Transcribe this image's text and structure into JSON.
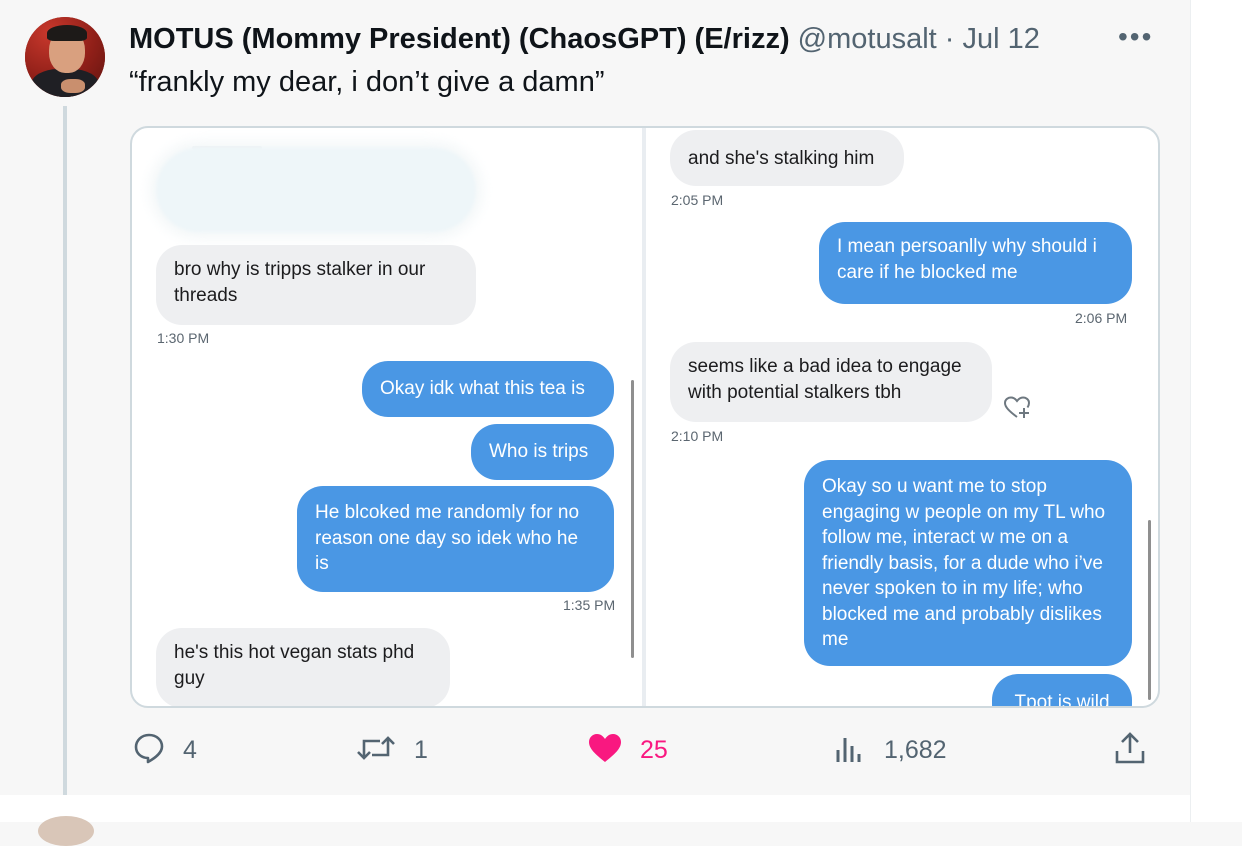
{
  "tweet": {
    "display_name": "MOTUS (Mommy President) (ChaosGPT) (E/rizz)",
    "handle": "@motusalt",
    "separator": "·",
    "date": "Jul 12",
    "more_label": "•••",
    "text": "“frankly my dear, i don’t give a damn”"
  },
  "screenshot": {
    "left": {
      "messages": [
        {
          "dir": "in",
          "text": "bro why is tripps stalker in our threads"
        },
        {
          "dir": "out",
          "text": "Okay idk what this tea is"
        },
        {
          "dir": "out",
          "text": "Who is trips"
        },
        {
          "dir": "out",
          "text": "He blcoked me randomly for no reason one day so idek who he is"
        },
        {
          "dir": "in",
          "text": "he's this hot vegan stats phd guy"
        }
      ],
      "times": [
        "1:30 PM",
        "1:35 PM"
      ]
    },
    "right": {
      "messages": [
        {
          "dir": "in",
          "text": "and she's stalking him"
        },
        {
          "dir": "out",
          "text": "I mean persoanlly why should i care if he blocked me"
        },
        {
          "dir": "in",
          "text": "seems like a bad idea to engage with potential stalkers tbh"
        },
        {
          "dir": "out",
          "text": "Okay so u want me to stop engaging w people on my TL who follow me, interact w me on a friendly basis, for a dude who i’ve never spoken to in my life; who blocked me and probably dislikes me"
        },
        {
          "dir": "out",
          "text": "Tpot is wild"
        }
      ],
      "times": [
        "2:05 PM",
        "2:06 PM",
        "2:10 PM"
      ]
    }
  },
  "actions": {
    "replies": "4",
    "retweets": "1",
    "likes": "25",
    "views": "1,682"
  },
  "icons": {
    "reply": "reply-icon",
    "retweet": "retweet-icon",
    "like": "heart-icon",
    "views": "views-icon",
    "share": "share-icon",
    "react": "heart-plus-icon"
  },
  "colors": {
    "like": "#f91880",
    "out_bubble": "#4a97e4",
    "in_bubble": "#eeeff1",
    "muted": "#536471"
  }
}
